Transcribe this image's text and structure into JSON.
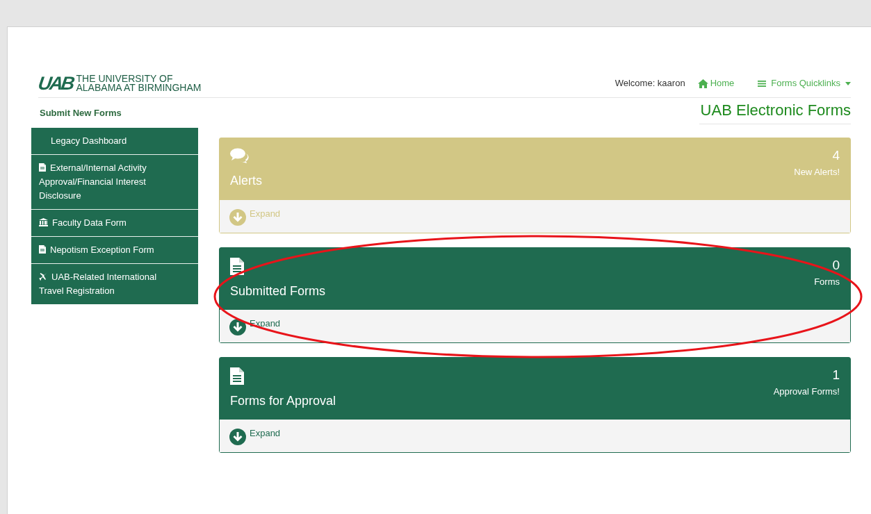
{
  "header": {
    "logo_mark": "UAB",
    "logo_line_1": "THE UNIVERSITY OF",
    "logo_line_2": "ALABAMA AT BIRMINGHAM",
    "welcome": "Welcome: kaaron",
    "nav": [
      {
        "kind": "home",
        "label": "Home"
      },
      {
        "kind": "menu",
        "label": "Forms Quicklinks"
      }
    ]
  },
  "page_title": "UAB Electronic Forms",
  "sidebar": {
    "heading": "Submit New Forms",
    "items": [
      {
        "kind": "plain",
        "label": "Legacy Dashboard"
      },
      {
        "kind": "document",
        "label": "External/Internal Activity Approval/Financial Interest Disclosure"
      },
      {
        "kind": "institution",
        "label": "Faculty Data Form"
      },
      {
        "kind": "document",
        "label": "Nepotism Exception Form"
      },
      {
        "kind": "travel",
        "label": "UAB-Related International Travel Registration"
      }
    ]
  },
  "panels": [
    {
      "kind": "alerts",
      "title": "Alerts",
      "count": "4",
      "count_label": "New Alerts!",
      "footer": "Expand"
    },
    {
      "kind": "forms",
      "title": "Submitted Forms",
      "count": "0",
      "count_label": "Forms",
      "footer": "Expand",
      "circled": true
    },
    {
      "kind": "forms",
      "title": "Forms for Approval",
      "count": "1",
      "count_label": "Approval Forms!",
      "footer": "Expand",
      "circled": false
    }
  ]
}
